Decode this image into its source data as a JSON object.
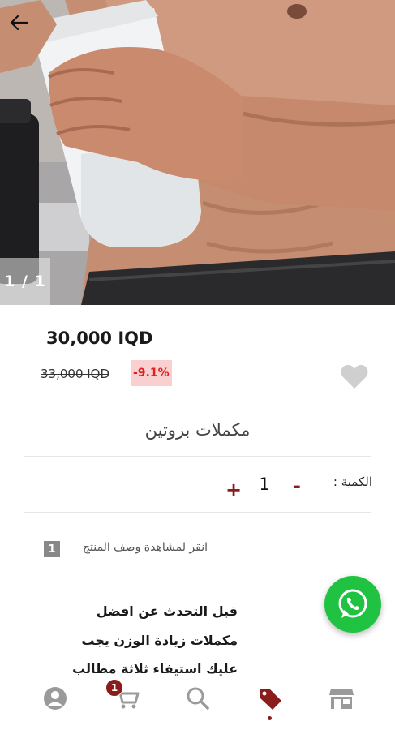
{
  "hero": {
    "counter": "1 / 1"
  },
  "product": {
    "price": "30,000 IQD",
    "old_price": "33,000 IQD",
    "discount": "-9.1%",
    "title": "مكملات  بروتين"
  },
  "quantity": {
    "label": "الكمية :",
    "minus": "-",
    "value": "1",
    "plus": "+"
  },
  "description": {
    "link_label": "انقر لمشاهدة وصف المنتج",
    "badge": "1",
    "lines": [
      "قبل التحدث عن افضل",
      "مكملات زيادة الوزن يجب",
      "عليك استيفاء ثلاثة مطالب"
    ]
  },
  "bottom_nav": {
    "cart_count": "1",
    "items": [
      "profile-icon",
      "cart-icon",
      "search-icon",
      "tag-icon",
      "store-icon"
    ]
  },
  "colors": {
    "accent": "#8b1c1c",
    "discount_bg": "#f9cfcf",
    "discount_text": "#e0201e",
    "whatsapp": "#1fc341"
  }
}
